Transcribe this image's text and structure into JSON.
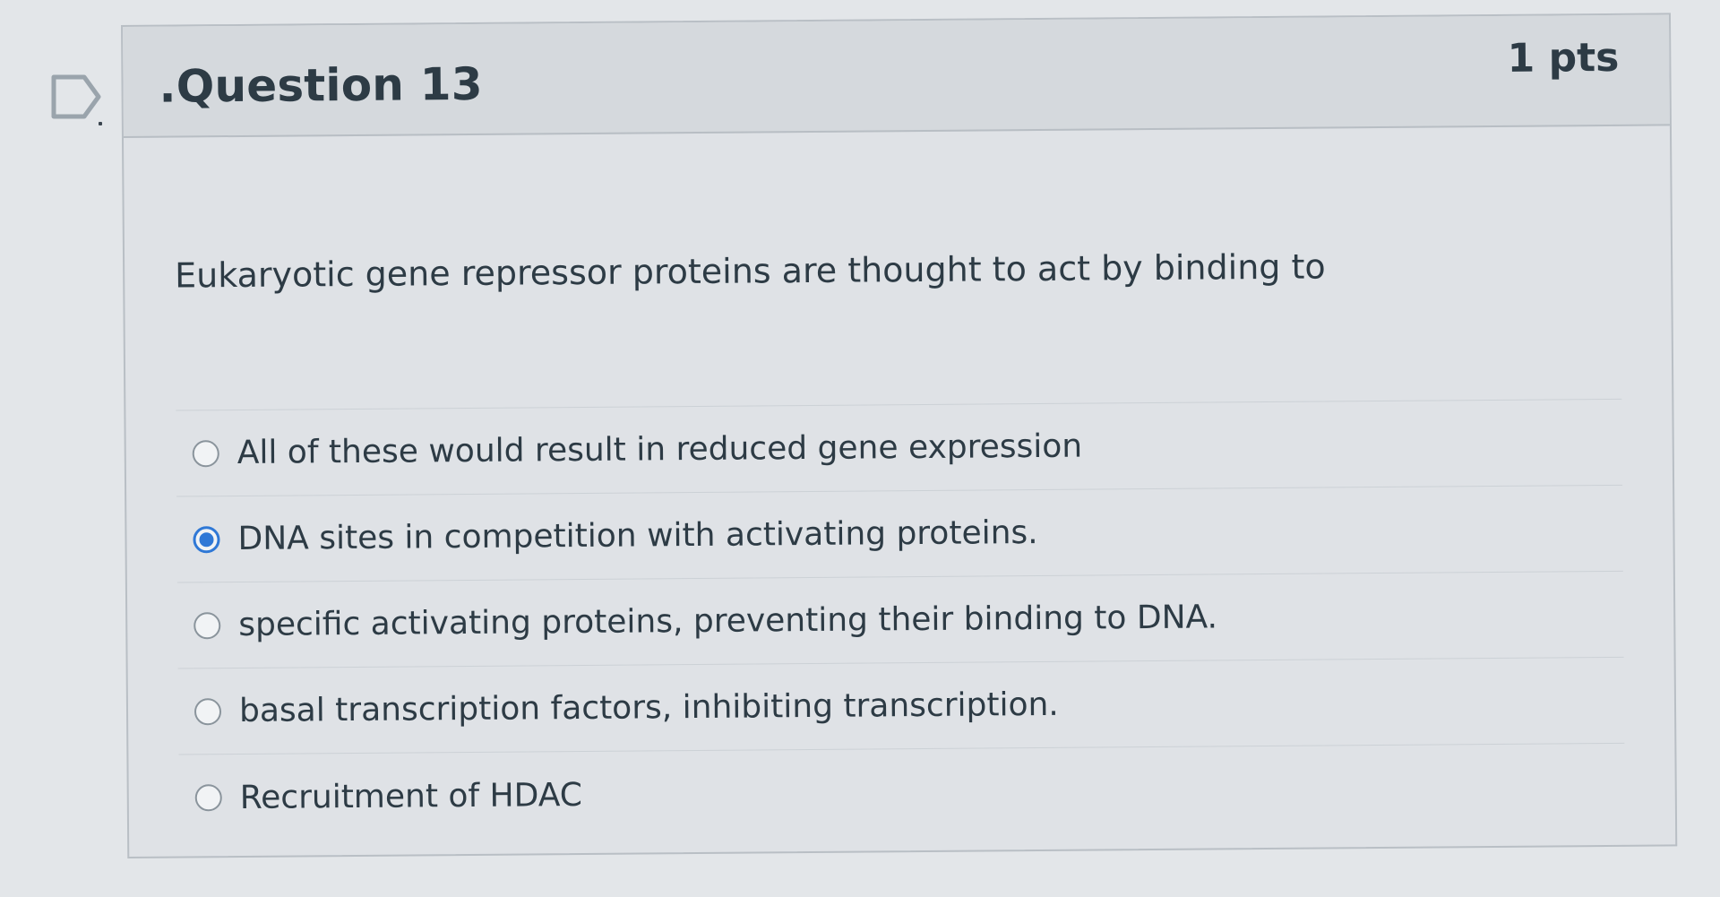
{
  "colors": {
    "accent": "#2f78d6",
    "text": "#2d3b45",
    "background": "#e3e6e9"
  },
  "question": {
    "flag_icon": "flag-outline-icon",
    "title": ".Question 13",
    "points": "1 pts",
    "text": "Eukaryotic gene repressor proteins are thought to act by binding to",
    "answers": [
      {
        "label": "All of these would result in reduced gene expression",
        "selected": false
      },
      {
        "label": "DNA sites in competition with activating proteins.",
        "selected": true
      },
      {
        "label": "specific activating proteins, preventing their binding to DNA.",
        "selected": false
      },
      {
        "label": "basal transcription factors, inhibiting transcription.",
        "selected": false
      },
      {
        "label": "Recruitment of HDAC",
        "selected": false
      }
    ]
  }
}
